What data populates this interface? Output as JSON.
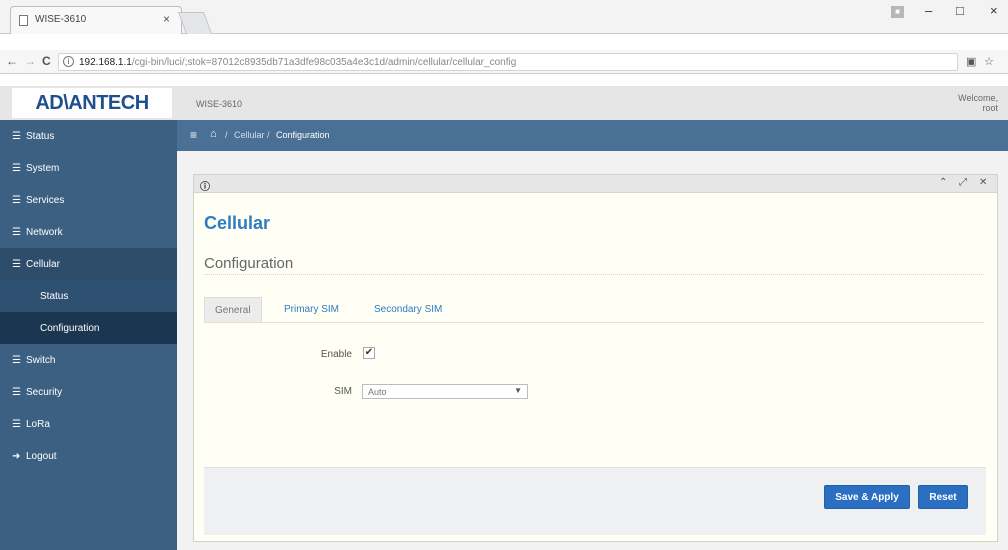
{
  "browser": {
    "tab_title": "WISE-3610",
    "tab_close": "×",
    "url_info": "ⓘ",
    "url_host": "192.168.1.1",
    "url_path": "/cgi-bin/luci/;stok=87012c8935db71a3dfe98c035a4e3c1d/admin/cellular/cellular_config",
    "back": "←",
    "forward": "→",
    "reload": "C",
    "win_minimize": "–",
    "win_maximize": "□",
    "win_close": "×",
    "ext1": "▣",
    "star": "☆"
  },
  "header": {
    "logo_text": "AD\\ANTECH",
    "device_name": "WISE-3610",
    "welcome_line1": "Welcome,",
    "welcome_line2": "root"
  },
  "sidebar": {
    "items": [
      {
        "label": "Status",
        "icon": "list-icon"
      },
      {
        "label": "System",
        "icon": "list-icon"
      },
      {
        "label": "Services",
        "icon": "list-icon"
      },
      {
        "label": "Network",
        "icon": "list-icon"
      },
      {
        "label": "Cellular",
        "icon": "list-icon"
      },
      {
        "label": "Status",
        "icon": ""
      },
      {
        "label": "Configuration",
        "icon": ""
      },
      {
        "label": "Switch",
        "icon": "list-icon"
      },
      {
        "label": "Security",
        "icon": "list-icon"
      },
      {
        "label": "LoRa",
        "icon": "list-icon"
      },
      {
        "label": "Logout",
        "icon": "logout-icon"
      }
    ]
  },
  "breadcrumb": {
    "sep": "/",
    "level1": "Cellular",
    "level2": "Configuration"
  },
  "panel": {
    "title": "Cellular",
    "section": "Configuration",
    "tabs": [
      "General",
      "Primary SIM",
      "Secondary SIM"
    ],
    "enable_label": "Enable",
    "enable_checked": true,
    "sim_label": "SIM",
    "sim_value": "Auto",
    "save_label": "Save & Apply",
    "reset_label": "Reset"
  },
  "colors": {
    "sidebar": "#3c6082",
    "accent": "#2f7cc0",
    "button": "#2b6fc3"
  }
}
